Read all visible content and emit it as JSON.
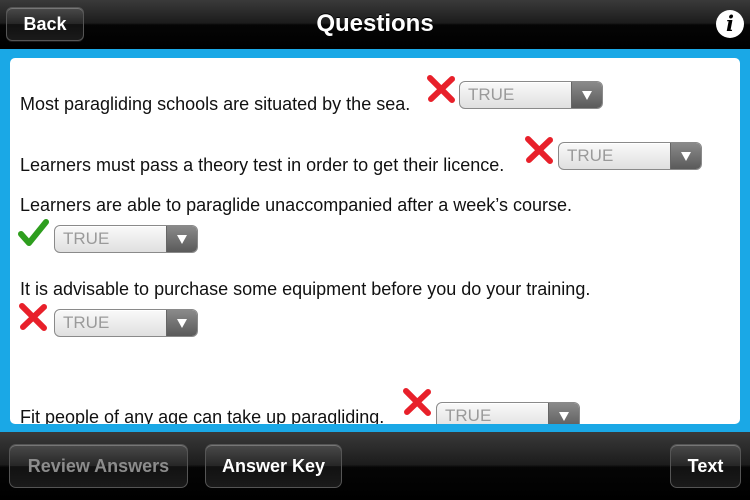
{
  "header": {
    "back_label": "Back",
    "title": "Questions",
    "info_label": "i"
  },
  "questions": [
    {
      "text": "Most paragliding schools are situated by the sea.",
      "mark": "wrong",
      "answer": "TRUE"
    },
    {
      "text": "Learners must pass a theory test in order to get their licence.",
      "mark": "wrong",
      "answer": "TRUE"
    },
    {
      "text": "Learners are able to paraglide unaccompanied after a week’s course.",
      "mark": "correct",
      "answer": "TRUE"
    },
    {
      "text": "It is advisable to purchase some equipment before you do your training.",
      "mark": "wrong",
      "answer": "TRUE"
    },
    {
      "text": "Fit people of any age can take up paragliding.",
      "mark": "wrong",
      "answer": "TRUE"
    }
  ],
  "footer": {
    "review_answers_label": "Review Answers",
    "answer_key_label": "Answer Key",
    "text_label": "Text"
  },
  "colors": {
    "frame_blue": "#1aa8e6",
    "wrong_mark": "#e8202a",
    "correct_mark": "#2e9e1e",
    "disabled_text": "#8c8c8c"
  },
  "icons": {
    "wrong": "cross-icon",
    "correct": "check-icon",
    "info": "info-icon",
    "dropdown": "chevron-down-icon"
  }
}
